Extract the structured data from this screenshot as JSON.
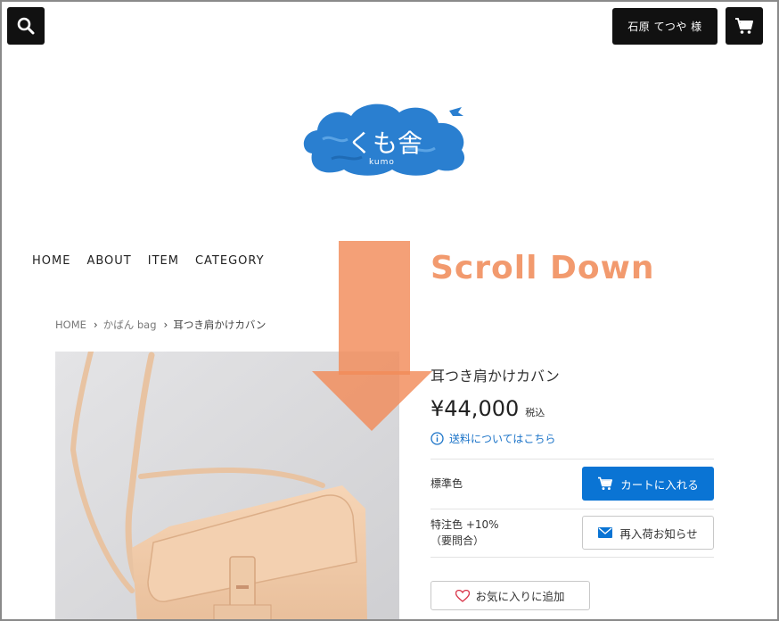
{
  "header": {
    "user_label": "石原 てつや 様",
    "search_icon": "search-icon",
    "cart_icon": "cart-icon"
  },
  "logo": {
    "text": "くも舎",
    "sub": "kumo",
    "color": "#2a7fd0"
  },
  "nav": {
    "items": [
      "HOME",
      "ABOUT",
      "ITEM",
      "CATEGORY"
    ]
  },
  "breadcrumb": {
    "home": "HOME",
    "category": "かばん bag",
    "current": "耳つき肩かけカバン"
  },
  "product": {
    "title": "耳つき肩かけカバン",
    "price": "¥44,000",
    "tax_label": "税込",
    "shipping_link": "送料についてはこちら",
    "variants": [
      {
        "label": "標準色",
        "button": "カートに入れる"
      },
      {
        "label": "特注色 +10%（要問合）",
        "button": "再入荷お知らせ"
      }
    ],
    "favorite_label": "お気に入りに追加"
  },
  "overlay": {
    "text": "Scroll Down",
    "color": "#f29a6e"
  },
  "colors": {
    "accent": "#0a74d4",
    "dark": "#111111"
  }
}
